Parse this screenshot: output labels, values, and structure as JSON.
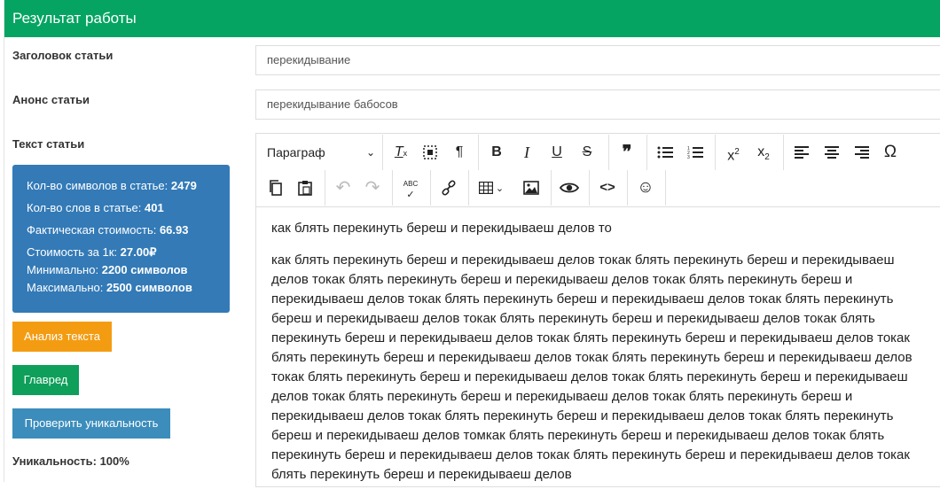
{
  "header": {
    "title": "Результат работы"
  },
  "fields": {
    "title_label": "Заголовок статьи",
    "title_value": "перекидывание",
    "announce_label": "Анонс статьи",
    "announce_value": "перекидывание бабосов",
    "text_label": "Текст статьи"
  },
  "stats": {
    "chars_label": "Кол-во символов в статье:",
    "chars_value": "2479",
    "words_label": "Кол-во слов в статье:",
    "words_value": "401",
    "cost_label": "Фактическая стоимость:",
    "cost_value": "66.93",
    "per1k_label": "Стоимость за 1к:",
    "per1k_value": "27.00₽",
    "min_label": "Минимально:",
    "min_value": "2200 символов",
    "max_label": "Максимально:",
    "max_value": "2500 символов"
  },
  "buttons": {
    "analyze": "Анализ текста",
    "glavred": "Главред",
    "unique": "Проверить уникальность"
  },
  "uniqueness": "Уникальность: 100%",
  "editor": {
    "paragraph_select": "Параграф",
    "toolbar": {
      "clear_format": "T",
      "bold": "B",
      "italic": "I",
      "underline": "U",
      "strike": "S",
      "quote": "❞",
      "superscript": "x",
      "subscript": "x",
      "omega": "Ω",
      "spellcheck": "ABC",
      "code": "<>",
      "emoji": "☺"
    },
    "paragraphs": [
      "как блять перекинуть береш и перекидываеш делов то",
      "как блять перекинуть береш и перекидываеш делов токак блять перекинуть береш и перекидываеш делов токак блять перекинуть береш и перекидываеш делов токак блять перекинуть береш и перекидываеш делов токак блять перекинуть береш и перекидываеш делов токак блять перекинуть береш и перекидываеш делов токак блять перекинуть береш и перекидываеш делов токак блять перекинуть береш и перекидываеш делов токак блять перекинуть береш и перекидываеш делов токак блять перекинуть береш и перекидываеш делов токак блять перекинуть береш и перекидываеш делов токак блять перекинуть береш и перекидываеш делов токак блять перекинуть береш и перекидываеш делов токак блять перекинуть береш и перекидываеш делов токак блять перекинуть береш и перекидываеш делов токак блять перекинуть береш и перекидываеш делов токак блять перекинуть береш и перекидываеш делов томкак блять перекинуть береш и перекидываеш делов токак блять перекинуть береш и перекидываеш делов токак блять перекинуть береш и перекидываеш делов токак блять перекинуть береш и перекидываеш делов"
    ]
  }
}
